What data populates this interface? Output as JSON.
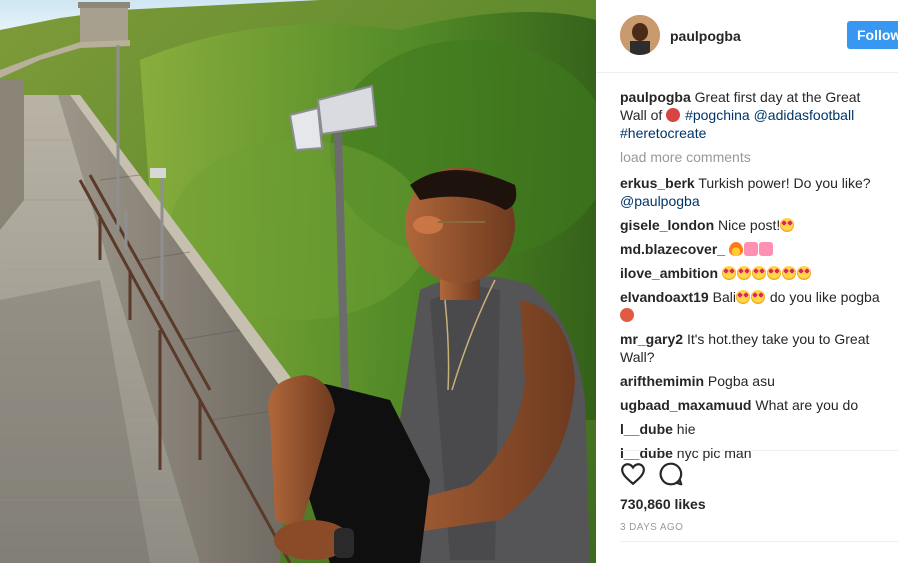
{
  "post": {
    "username": "paulpogba",
    "follow_label": "Follow",
    "caption_user": "paulpogba",
    "caption_text": "Great first day at the Great Wall of",
    "caption_flag_icon": "china-flag-icon",
    "caption_tag1": "#pogchina",
    "caption_mention": "@adidasfootball",
    "caption_tag2": "#heretocreate",
    "load_more": "load more comments",
    "likes": "730,860 likes",
    "timestamp": "3 DAYS AGO",
    "like_icon": "heart-outline-icon",
    "comment_icon": "speech-bubble-icon"
  },
  "comments": [
    {
      "user": "erkus_berk",
      "text": "Turkish power! Do you like?",
      "mention": "@paulpogba"
    },
    {
      "user": "gisele_london",
      "text": "Nice post!",
      "emoji": "heart-eyes-emoji"
    },
    {
      "user": "md.blazecover_",
      "text": "",
      "emoji": "fire-and-pink-bow-emoji"
    },
    {
      "user": "ilove_ambition",
      "text": "",
      "emoji": "heart-eyes-emoji-x6"
    },
    {
      "user": "elvandoaxt19",
      "text_before": "Bali",
      "text_after": "do you like pogba",
      "emoji": "heart-eyes-emoji"
    },
    {
      "user": "mr_gary2",
      "text": "It's hot.they take you to Great Wall?"
    },
    {
      "user": "arifthemimin",
      "text": "Pogba asu"
    },
    {
      "user": "ugbaad_maxamuud",
      "text": "What are you do"
    },
    {
      "user": "l__dube",
      "text": "hie"
    },
    {
      "user": "l__dube",
      "text": "nyc pic man"
    }
  ],
  "colors": {
    "follow_blue": "#3897f0",
    "link_blue": "#003569",
    "muted_gray": "#999999"
  }
}
